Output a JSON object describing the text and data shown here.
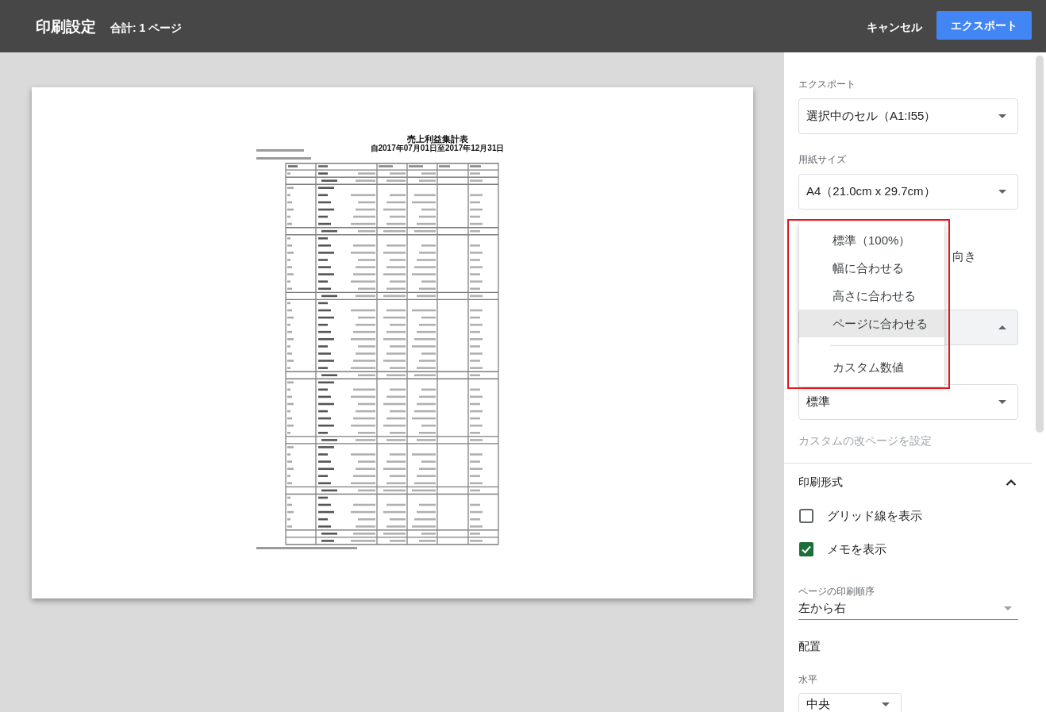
{
  "header": {
    "title": "印刷設定",
    "summary": "合計: 1 ページ",
    "actions": [
      {
        "label": "キャンセル",
        "kind": "text"
      },
      {
        "label": "エクスポート",
        "kind": "primary"
      }
    ]
  },
  "preview": {
    "title": "売上利益集計表",
    "period": "自2017年07月01日至2017年12月31日"
  },
  "settings": {
    "export": {
      "label": "エクスポート",
      "value": "選択中のセル（A1:I55）"
    },
    "paper_size": {
      "label": "用紙サイズ",
      "value": "A4（21.0cm x 29.7cm）"
    },
    "orientation": {
      "label": "向き"
    },
    "scale": {
      "expanded": true,
      "highlighted": true,
      "options": [
        {
          "label": "標準（100%）",
          "selected": false
        },
        {
          "label": "幅に合わせる",
          "selected": false
        },
        {
          "label": "高さに合わせる",
          "selected": false
        },
        {
          "label": "ページに合わせる",
          "selected": true
        }
      ],
      "extra_options": [
        {
          "label": "カスタム数値",
          "selected": false
        }
      ]
    },
    "page_breaks": {
      "value": "標準"
    },
    "custom_breaks_link": {
      "label": "カスタムの改ページを設定",
      "disabled": true
    }
  },
  "print_format": {
    "title": "印刷形式",
    "expanded": true,
    "options": [
      {
        "label": "グリッド線を表示",
        "checked": false
      },
      {
        "label": "メモを表示",
        "checked": true
      }
    ],
    "page_order": {
      "label": "ページの印刷順序",
      "value": "左から右"
    }
  },
  "alignment": {
    "title": "配置",
    "horizontal": {
      "label": "水平",
      "value": "中央"
    }
  }
}
